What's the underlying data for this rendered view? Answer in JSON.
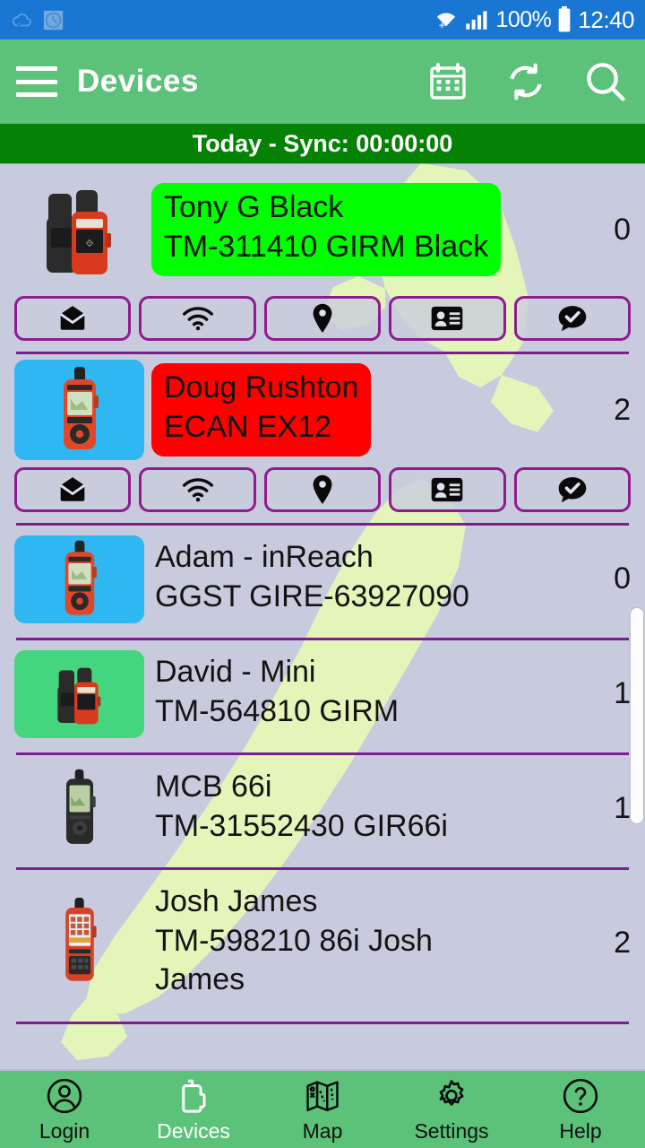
{
  "statusbar": {
    "icons": [
      "cloud-sync-icon",
      "alarm-clock-icon",
      "wifi-icon",
      "signal-icon"
    ],
    "battery_percent": "100%",
    "time": "12:40"
  },
  "appbar": {
    "menu_icon": "hamburger-menu-icon",
    "title": "Devices",
    "actions": [
      {
        "name": "calendar-icon",
        "label": "Calendar"
      },
      {
        "name": "refresh-icon",
        "label": "Sync"
      },
      {
        "name": "search-icon",
        "label": "Search"
      }
    ]
  },
  "syncbar": {
    "text": "Today - Sync: 00:00:00"
  },
  "colors": {
    "status_bar": "#1976d2",
    "app_bar": "#5cc279",
    "sync_bar": "#058205",
    "page_background": "#c8cbdd",
    "map_land": "#e0f5b4",
    "divider": "#7b1f8f",
    "action_border": "#8e1c8e",
    "highlight_green": "#00ff00",
    "highlight_red": "#fe0000",
    "thumb_blue": "#2eb7f0",
    "thumb_green": "#44d67e"
  },
  "action_buttons": [
    {
      "name": "message-icon",
      "label": "Messages"
    },
    {
      "name": "wifi-icon",
      "label": "Signal"
    },
    {
      "name": "location-pin-icon",
      "label": "Location"
    },
    {
      "name": "contact-card-icon",
      "label": "Contact"
    },
    {
      "name": "chat-check-icon",
      "label": "Confirm"
    }
  ],
  "devices": [
    {
      "name": "Tony G Black",
      "detail": "TM-311410 GIRM Black",
      "count": "0",
      "highlight": "green",
      "thumb_bg": "none",
      "thumb_type": "mini-pair",
      "expanded": true
    },
    {
      "name": "Doug Rushton",
      "detail": "ECAN EX12",
      "count": "2",
      "highlight": "red",
      "thumb_bg": "blue",
      "thumb_type": "inreach-explorer",
      "expanded": true
    },
    {
      "name": "Adam - inReach",
      "detail": "GGST GIRE-63927090",
      "count": "0",
      "highlight": "none",
      "thumb_bg": "blue",
      "thumb_type": "inreach-explorer",
      "expanded": false
    },
    {
      "name": "David - Mini",
      "detail": "TM-564810 GIRM",
      "count": "1",
      "highlight": "none",
      "thumb_bg": "green",
      "thumb_type": "mini-pair",
      "expanded": false
    },
    {
      "name": "MCB 66i",
      "detail": "TM-31552430 GIR66i",
      "count": "1",
      "highlight": "none",
      "thumb_bg": "none",
      "thumb_type": "gpsmap-66i",
      "expanded": false
    },
    {
      "name": "Josh James",
      "detail": "TM-598210 86i Josh James",
      "count": "2",
      "highlight": "none",
      "thumb_bg": "none",
      "thumb_type": "gpsmap-86i",
      "expanded": false
    }
  ],
  "bottomnav": {
    "items": [
      {
        "label": "Login",
        "icon": "user-circle-icon",
        "active": false
      },
      {
        "label": "Devices",
        "icon": "handheld-radio-icon",
        "active": true
      },
      {
        "label": "Map",
        "icon": "folded-map-icon",
        "active": false
      },
      {
        "label": "Settings",
        "icon": "gear-icon",
        "active": false
      },
      {
        "label": "Help",
        "icon": "question-circle-icon",
        "active": false
      }
    ]
  }
}
